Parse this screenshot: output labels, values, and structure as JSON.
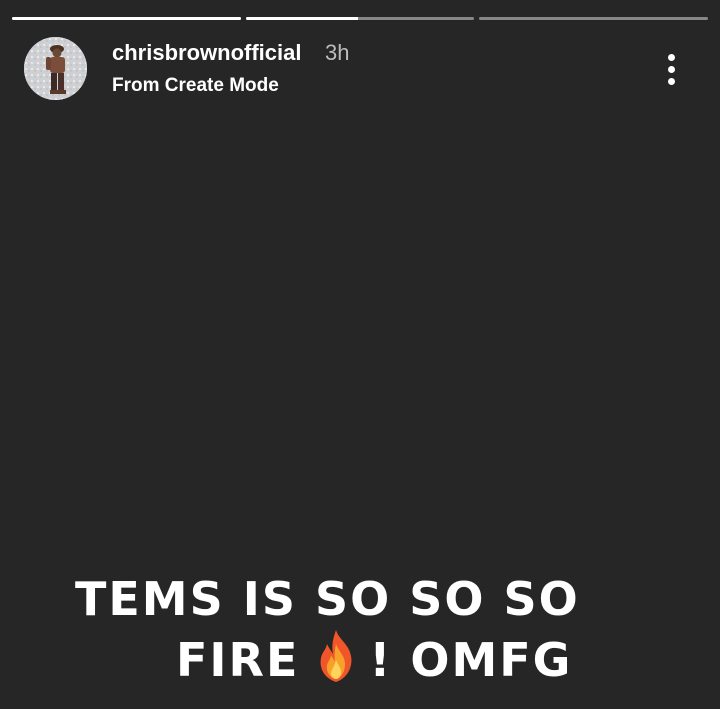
{
  "story": {
    "progress": [
      {
        "fill": 1.0
      },
      {
        "fill": 0.49
      },
      {
        "fill": 0.0
      }
    ],
    "header": {
      "username": "chrisbrownofficial",
      "time": "3h",
      "subtitle": "From Create Mode",
      "avatar_icon": "profile-avatar",
      "menu_icon": "more-vertical-icon"
    },
    "caption": {
      "line1": "TEMS IS SO SO SO",
      "line2_before": "FIRE",
      "line2_emoji": "fire-emoji",
      "line2_after": "! OMFG"
    },
    "colors": {
      "background": "#262626",
      "text": "#ffffff",
      "time": "#bdbdbd"
    }
  }
}
